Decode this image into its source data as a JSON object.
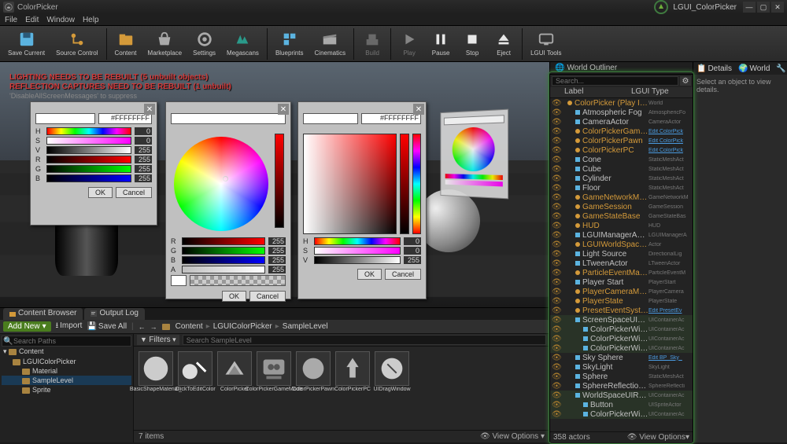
{
  "titlebar": {
    "left_title": "ColorPicker",
    "right_title": "LGUI_ColorPicker"
  },
  "menu": [
    "File",
    "Edit",
    "Window",
    "Help"
  ],
  "toolbar": [
    {
      "id": "save",
      "label": "Save Current"
    },
    {
      "id": "source",
      "label": "Source Control"
    },
    {
      "id": "content",
      "label": "Content"
    },
    {
      "id": "market",
      "label": "Marketplace"
    },
    {
      "id": "settings",
      "label": "Settings"
    },
    {
      "id": "megascans",
      "label": "Megascans"
    },
    {
      "id": "blueprints",
      "label": "Blueprints"
    },
    {
      "id": "cinematics",
      "label": "Cinematics"
    },
    {
      "id": "build",
      "label": "Build"
    },
    {
      "id": "play",
      "label": "Play"
    },
    {
      "id": "pause",
      "label": "Pause"
    },
    {
      "id": "stop",
      "label": "Stop"
    },
    {
      "id": "eject",
      "label": "Eject"
    },
    {
      "id": "lgui",
      "label": "LGUI Tools"
    }
  ],
  "viewport": {
    "warn1": "LIGHTING NEEDS TO BE REBUILT (5 unbuilt objects)",
    "warn2": "REFLECTION CAPTURES NEED TO BE REBUILT (1 unbuilt)",
    "warn3": "'DisableAllScreenMessages' to suppress"
  },
  "panel1": {
    "hex": "#FFFFFFFF",
    "rows": [
      {
        "l": "H",
        "v": "0"
      },
      {
        "l": "S",
        "v": "0"
      },
      {
        "l": "V",
        "v": "255"
      },
      {
        "l": "R",
        "v": "255"
      },
      {
        "l": "G",
        "v": "255"
      },
      {
        "l": "B",
        "v": "255"
      }
    ],
    "ok": "OK",
    "cancel": "Cancel"
  },
  "panel2": {
    "rows": [
      {
        "l": "R",
        "v": "255"
      },
      {
        "l": "G",
        "v": "255"
      },
      {
        "l": "B",
        "v": "255"
      },
      {
        "l": "A",
        "v": "255"
      }
    ],
    "ok": "OK",
    "cancel": "Cancel"
  },
  "panel3": {
    "hex": "#FFFFFFFF",
    "rows": [
      {
        "l": "H",
        "v": "0"
      },
      {
        "l": "S",
        "v": "0"
      },
      {
        "l": "V",
        "v": "255"
      }
    ],
    "ok": "OK",
    "cancel": "Cancel"
  },
  "tabs": {
    "cb": "Content Browser",
    "ol": "Output Log"
  },
  "cb": {
    "addnew": "Add New",
    "import": "Import",
    "saveall": "Save All",
    "crumbs": [
      "Content",
      "LGUIColorPicker",
      "SampleLevel"
    ],
    "search_tree_ph": "Search Paths",
    "tree": [
      {
        "n": "Content",
        "d": 0
      },
      {
        "n": "LGUIColorPicker",
        "d": 1
      },
      {
        "n": "Material",
        "d": 2
      },
      {
        "n": "SampleLevel",
        "d": 2,
        "sel": true
      },
      {
        "n": "Sprite",
        "d": 2
      }
    ],
    "filters": "Filters",
    "search_assets_ph": "Search SampleLevel",
    "assets": [
      "BasicShapeMaterial_",
      "ClickToEditColor",
      "ColorPicker",
      "ColorPickerGameMode",
      "ColorPickerPawn",
      "ColorPickerPC",
      "UIDragWindow"
    ],
    "items": "7 items",
    "viewopt": "View Options"
  },
  "outliner": {
    "tab": "World Outliner",
    "search_ph": "Search...",
    "cols": {
      "label": "Label",
      "lgui": "LGUI",
      "type": "Type"
    },
    "rows": [
      {
        "n": "ColorPicker (Play In Editor)",
        "t": "World",
        "d": 0,
        "c": "orange"
      },
      {
        "n": "Atmospheric Fog",
        "t": "AtmosphericFo",
        "d": 1
      },
      {
        "n": "CameraActor",
        "t": "CameraActor",
        "d": 1
      },
      {
        "n": "ColorPickerGameMode",
        "t": "Edit ColorPick",
        "d": 1,
        "c": "orange",
        "link": true
      },
      {
        "n": "ColorPickerPawn",
        "t": "Edit ColorPick",
        "d": 1,
        "c": "orange",
        "link": true
      },
      {
        "n": "ColorPickerPC",
        "t": "Edit ColorPick",
        "d": 1,
        "c": "orange",
        "link": true
      },
      {
        "n": "Cone",
        "t": "StaticMeshAct",
        "d": 1
      },
      {
        "n": "Cube",
        "t": "StaticMeshAct",
        "d": 1
      },
      {
        "n": "Cylinder",
        "t": "StaticMeshAct",
        "d": 1
      },
      {
        "n": "Floor",
        "t": "StaticMeshAct",
        "d": 1
      },
      {
        "n": "GameNetworkManager",
        "t": "GameNetworkM",
        "d": 1,
        "c": "orange"
      },
      {
        "n": "GameSession",
        "t": "GameSession",
        "d": 1,
        "c": "orange"
      },
      {
        "n": "GameStateBase",
        "t": "GameStateBas",
        "d": 1,
        "c": "orange"
      },
      {
        "n": "HUD",
        "t": "HUD",
        "d": 1,
        "c": "orange"
      },
      {
        "n": "LGUIManagerActor",
        "t": "LGUIManagerA",
        "d": 1
      },
      {
        "n": "LGUIWorldSpaceInteraction",
        "t": "Actor",
        "d": 1,
        "c": "orange"
      },
      {
        "n": "Light Source",
        "t": "DirectionalLig",
        "d": 1
      },
      {
        "n": "LTweenActor",
        "t": "LTweenActor",
        "d": 1
      },
      {
        "n": "ParticleEventManager",
        "t": "ParticleEventM",
        "d": 1,
        "c": "orange"
      },
      {
        "n": "Player Start",
        "t": "PlayerStart",
        "d": 1
      },
      {
        "n": "PlayerCameraManager",
        "t": "PlayerCamera",
        "d": 1,
        "c": "orange"
      },
      {
        "n": "PlayerState",
        "t": "PlayerState",
        "d": 1,
        "c": "orange"
      },
      {
        "n": "PresetEventSystemActor",
        "t": "Edit PresetEv",
        "d": 1,
        "c": "orange",
        "link": true
      },
      {
        "n": "ScreenSpaceUIRoot",
        "t": "UIContainerAc",
        "d": 1,
        "hi": true
      },
      {
        "n": "ColorPickerWindow",
        "t": "UIContainerAc",
        "d": 2,
        "hi": true
      },
      {
        "n": "ColorPickerWindow",
        "t": "UIContainerAc",
        "d": 2,
        "hi": true
      },
      {
        "n": "ColorPickerWindow",
        "t": "UIContainerAc",
        "d": 2,
        "hi": true
      },
      {
        "n": "Sky Sphere",
        "t": "Edit BP_Sky_",
        "d": 1,
        "link": true
      },
      {
        "n": "SkyLight",
        "t": "SkyLight",
        "d": 1
      },
      {
        "n": "Sphere",
        "t": "StaticMeshAct",
        "d": 1
      },
      {
        "n": "SphereReflectionCapture",
        "t": "SphereReflecti",
        "d": 1
      },
      {
        "n": "WorldSpaceUIRoot",
        "t": "UIContainerAc",
        "d": 1,
        "hi": true
      },
      {
        "n": "Button",
        "t": "UISpriteActor",
        "d": 2,
        "hi": true
      },
      {
        "n": "ColorPickerWindow",
        "t": "UIContainerAc",
        "d": 2,
        "hi": true
      }
    ],
    "count": "358 actors",
    "viewopt": "View Options"
  },
  "details": {
    "tabs": [
      "Details",
      "World",
      "Modes"
    ],
    "empty": "Select an object to view details."
  }
}
